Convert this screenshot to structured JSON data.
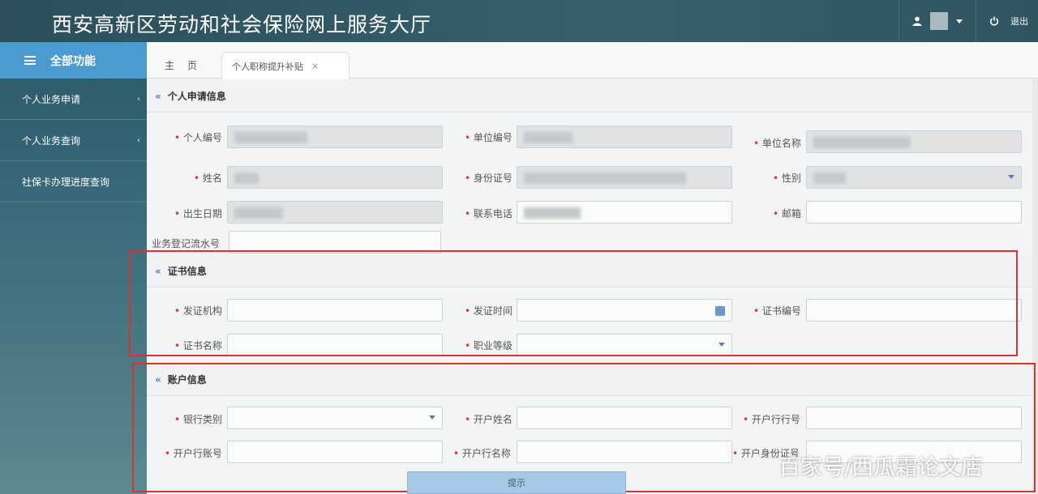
{
  "header": {
    "title": "西安高新区劳动和社会保险网上服务大厅",
    "logout_label": "退出",
    "avatar_redacted": true
  },
  "sidebar": {
    "menu_title": "全部功能",
    "items": [
      {
        "label": "个人业务申请",
        "arrow": "‹"
      },
      {
        "label": "个人业务查询",
        "arrow": "‹"
      },
      {
        "label": "社保卡办理进度查询",
        "arrow": ""
      }
    ]
  },
  "tabs": {
    "home": "主 页",
    "active": "个人职称提升补贴",
    "close": "×"
  },
  "sections": {
    "personal": {
      "title": "个人申请信息",
      "labels": {
        "person_no": "个人编号",
        "unit_no": "单位编号",
        "unit_name": "单位名称",
        "name": "姓名",
        "id_no": "身份证号",
        "gender": "性别",
        "birth": "出生日期",
        "phone": "联系电话",
        "email": "邮箱",
        "reg_no": "业务登记流水号"
      }
    },
    "certificate": {
      "title": "证书信息",
      "labels": {
        "issuer": "发证机构",
        "issue_date": "发证时间",
        "cert_no": "证书编号",
        "cert_name": "证书名称",
        "level": "职业等级"
      }
    },
    "bank": {
      "title": "账户信息",
      "labels": {
        "bank_type": "银行类别",
        "account_name": "开户姓名",
        "branch": "开户行行号",
        "account_no": "开户行账号",
        "branch_name": "开户行名称",
        "id_no": "开户身份证号"
      }
    }
  },
  "submit_label": "提示",
  "watermark": "百家号/西瓜霜论文店",
  "colors": {
    "topbar": "#2d4f5c",
    "menu_head": "#4b9ad0",
    "highlight": "#d9342b"
  }
}
